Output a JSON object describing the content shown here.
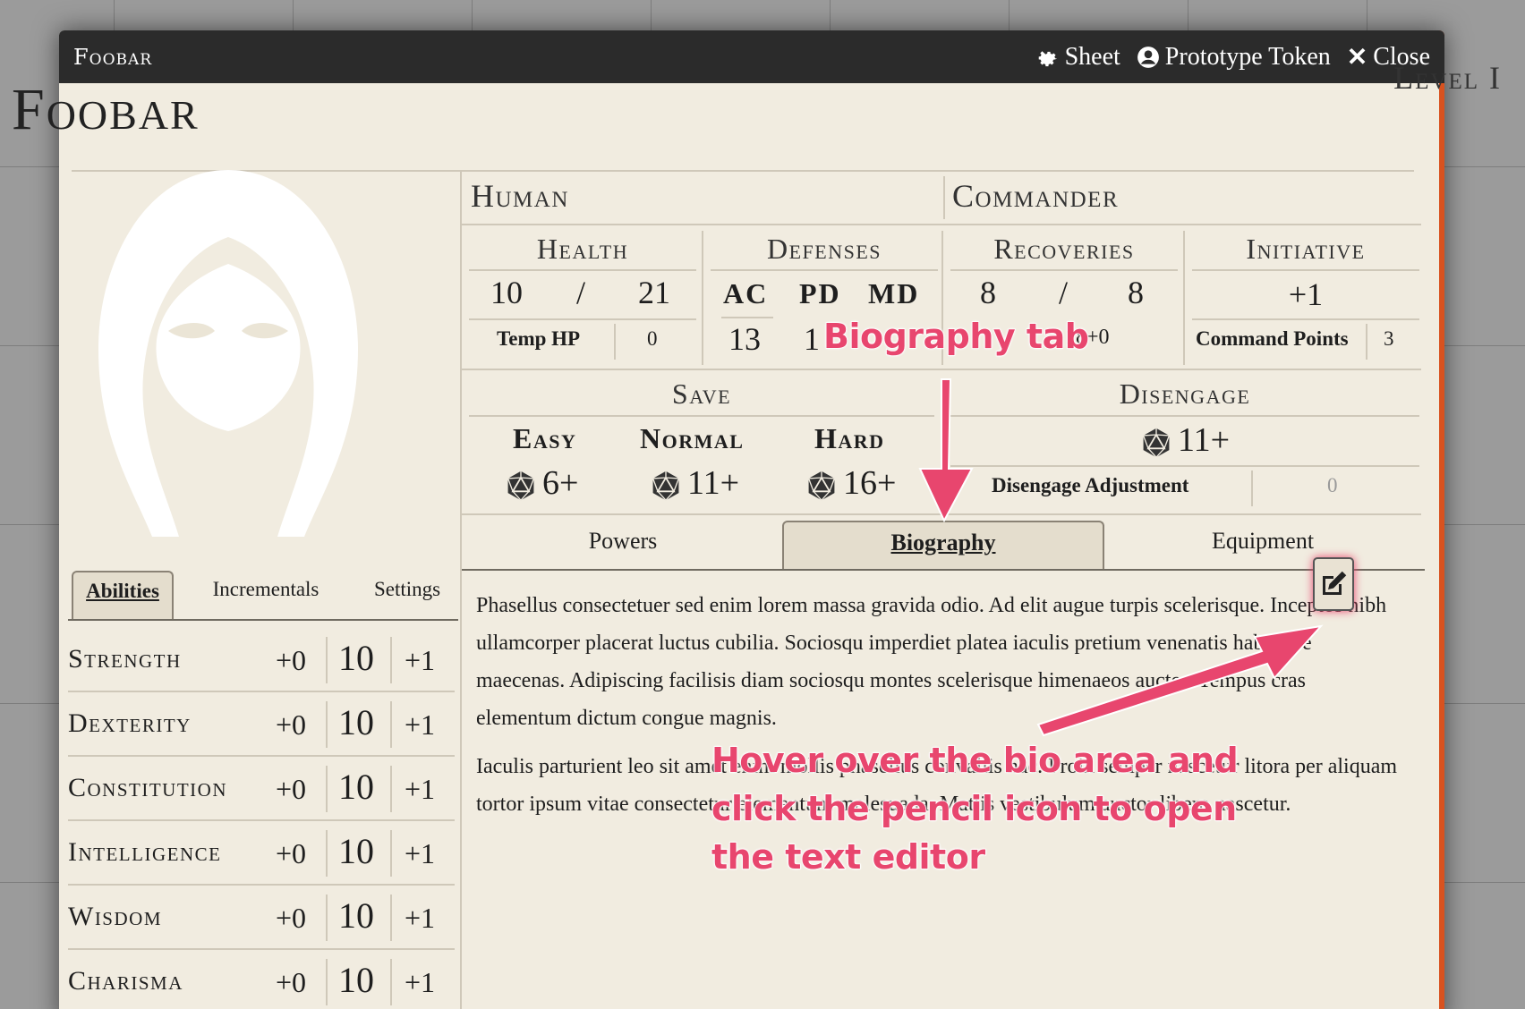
{
  "window": {
    "title": "Foobar",
    "controls": {
      "sheet": "Sheet",
      "token": "Prototype Token",
      "close": "Close"
    }
  },
  "header": {
    "name": "Foobar",
    "level": "Level I",
    "race": "Human",
    "class": "Commander"
  },
  "health": {
    "label": "Health",
    "current": "10",
    "sep": "/",
    "max": "21",
    "temp_label": "Temp HP",
    "temp_value": "0"
  },
  "defenses": {
    "label": "Defenses",
    "ac_label": "AC",
    "pd_label": "PD",
    "md_label": "MD",
    "ac": "13",
    "pd": "1"
  },
  "recoveries": {
    "label": "Recoveries",
    "current": "8",
    "sep": "/",
    "max": "8",
    "roll": "18+0"
  },
  "initiative": {
    "label": "Initiative",
    "value": "+1",
    "cp_label": "Command Points",
    "cp_value": "3"
  },
  "save": {
    "label": "Save",
    "easy_label": "Easy",
    "easy": "6+",
    "normal_label": "Normal",
    "normal": "11+",
    "hard_label": "Hard",
    "hard": "16+"
  },
  "disengage": {
    "label": "Disengage",
    "value": "11+",
    "adj_label": "Disengage Adjustment",
    "adj_value": "0"
  },
  "main_tabs": [
    "Powers",
    "Biography",
    "Equipment"
  ],
  "left_tabs": [
    "Abilities",
    "Incrementals",
    "Settings"
  ],
  "abilities": [
    {
      "name": "Strength",
      "mod": "+0",
      "score": "10",
      "lvl": "+1"
    },
    {
      "name": "Dexterity",
      "mod": "+0",
      "score": "10",
      "lvl": "+1"
    },
    {
      "name": "Constitution",
      "mod": "+0",
      "score": "10",
      "lvl": "+1"
    },
    {
      "name": "Intelligence",
      "mod": "+0",
      "score": "10",
      "lvl": "+1"
    },
    {
      "name": "Wisdom",
      "mod": "+0",
      "score": "10",
      "lvl": "+1"
    },
    {
      "name": "Charisma",
      "mod": "+0",
      "score": "10",
      "lvl": "+1"
    }
  ],
  "biography": {
    "p1": "Phasellus consectetuer sed enim lorem massa gravida odio. Ad elit augue turpis scelerisque. Inceptos nibh ullamcorper placerat luctus cubilia. Sociosqu imperdiet platea iaculis pretium venenatis habitasse maecenas. Adipiscing facilisis diam sociosqu montes scelerisque himenaeos auctor. Tempus cras elementum dictum congue magnis.",
    "p2": "Iaculis parturient leo sit amet enim mollis phasellus convallis hac. Proin semper nascetur litora per aliquam tortor ipsum vitae consectetur elementum malesuada. Mattis vestibulum auctor libero nascetur."
  },
  "annotations": {
    "tab_note": "Biography tab",
    "hover_note_1": "Hover over the bio area and",
    "hover_note_2": "click the pencil icon to open",
    "hover_note_3": "the text editor",
    "color": "#e8466e"
  },
  "icons": [
    "gear-icon",
    "user-circle-icon",
    "close-icon",
    "d20-icon",
    "pencil-square-icon",
    "hooded-figure-icon"
  ]
}
